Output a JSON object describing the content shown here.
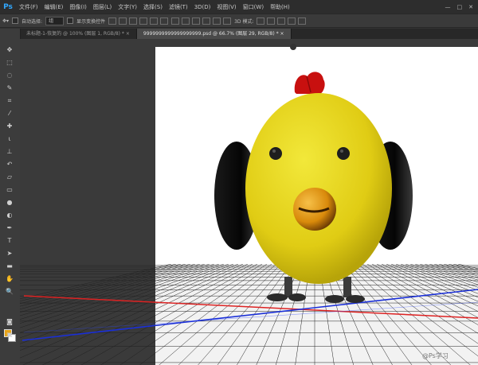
{
  "app": {
    "logo": "Ps",
    "menu": [
      "文件(F)",
      "编辑(E)",
      "图像(I)",
      "图层(L)",
      "文字(Y)",
      "选择(S)",
      "滤镜(T)",
      "3D(D)",
      "视图(V)",
      "窗口(W)",
      "帮助(H)"
    ],
    "win_controls": [
      "—",
      "□",
      "✕"
    ]
  },
  "options_bar": {
    "auto_select_label": "自动选择:",
    "auto_select_value": "组",
    "show_transform_label": "显示变换控件",
    "mode_label": "3D 模式:"
  },
  "tabs": [
    {
      "label": "未标题-1-恢复的 @ 100% (图层 1, RGB/8) *",
      "close": "×"
    },
    {
      "label": "9999999999999999999.psd @ 66.7% (图层 29, RGB/8) *",
      "close": "×"
    }
  ],
  "tools": [
    "move-tool",
    "marquee-tool",
    "lasso-tool",
    "quick-select-tool",
    "crop-tool",
    "eyedropper-tool",
    "healing-brush-tool",
    "brush-tool",
    "stamp-tool",
    "history-brush-tool",
    "eraser-tool",
    "gradient-tool",
    "blur-tool",
    "dodge-tool",
    "pen-tool",
    "type-tool",
    "path-select-tool",
    "shape-tool",
    "hand-tool",
    "zoom-tool"
  ],
  "colors": {
    "foreground": "#e8a317",
    "background": "#ffffff",
    "body_yellow": "#e7d21a",
    "comb_red": "#c8100f",
    "beak_orange": "#e59a10"
  },
  "watermark": "@Ps学习"
}
